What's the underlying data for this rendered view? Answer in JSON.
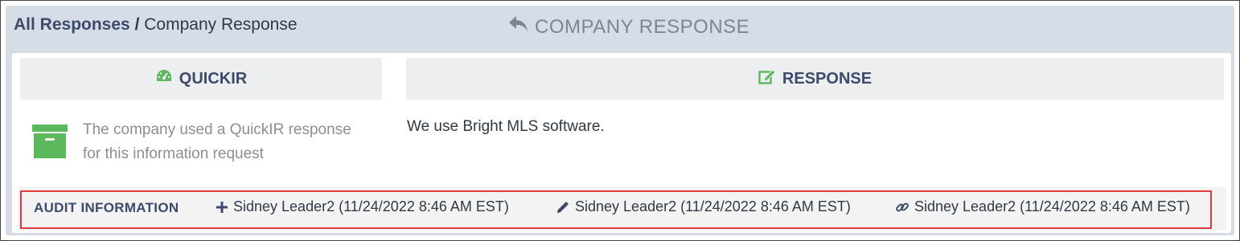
{
  "breadcrumb": {
    "parent": "All Responses",
    "separator": "/",
    "current": "Company Response"
  },
  "header": {
    "title": "COMPANY RESPONSE",
    "back_icon": "reply-icon"
  },
  "tabs": {
    "quick": {
      "label": "QUICKIR",
      "icon": "dashboard-icon"
    },
    "response": {
      "label": "RESPONSE",
      "icon": "edit-icon"
    }
  },
  "quickir": {
    "line1": "The company used a QuickIR response",
    "line2": "for this information request",
    "icon": "archive-icon"
  },
  "response": {
    "text": "We use Bright MLS software."
  },
  "audit": {
    "label": "AUDIT INFORMATION",
    "created": {
      "icon": "plus-icon",
      "text": "Sidney Leader2 (11/24/2022 8:46 AM EST)"
    },
    "edited": {
      "icon": "pencil-icon",
      "text": "Sidney Leader2 (11/24/2022 8:46 AM EST)"
    },
    "linked": {
      "icon": "link-icon",
      "text": "Sidney Leader2 (11/24/2022 8:46 AM EST)"
    }
  },
  "colors": {
    "accent_green": "#5cb85c",
    "nav_blue": "#3d4a6b",
    "highlight_red": "#e03a3e",
    "panel_bg": "#d7dde6"
  }
}
